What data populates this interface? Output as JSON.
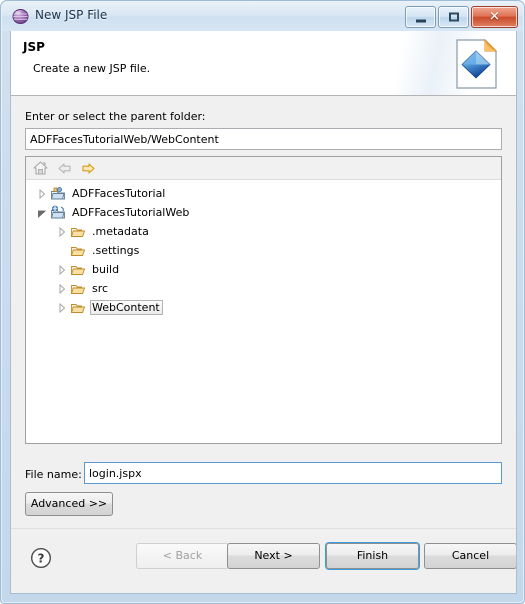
{
  "window": {
    "title": "New JSP File",
    "icon": "eclipse-sphere-icon",
    "controls": {
      "minimize_label": "Minimize",
      "maximize_label": "Restore",
      "close_label": "Close",
      "close_glyph": "✕"
    }
  },
  "header": {
    "title": "JSP",
    "description": "Create a new JSP file.",
    "icon": "jsp-file-wizard-icon"
  },
  "main": {
    "parent_folder": {
      "label": "Enter or select the parent folder:",
      "value": "ADFFacesTutorialWeb/WebContent",
      "placeholder": ""
    },
    "tree_toolbar": [
      {
        "name": "home-icon",
        "enabled": false
      },
      {
        "name": "back-arrow-icon",
        "enabled": false
      },
      {
        "name": "forward-arrow-icon",
        "enabled": true
      }
    ],
    "tree": [
      {
        "label": "ADFFacesTutorial",
        "icon": "project-icon",
        "indent": 0,
        "twisty": "collapsed",
        "selected": false
      },
      {
        "label": "ADFFacesTutorialWeb",
        "icon": "web-project-icon",
        "indent": 0,
        "twisty": "expanded",
        "selected": false
      },
      {
        "label": ".metadata",
        "icon": "folder-icon",
        "indent": 1,
        "twisty": "collapsed",
        "selected": false
      },
      {
        "label": ".settings",
        "icon": "folder-icon",
        "indent": 1,
        "twisty": "none",
        "selected": false
      },
      {
        "label": "build",
        "icon": "folder-icon",
        "indent": 1,
        "twisty": "collapsed",
        "selected": false
      },
      {
        "label": "src",
        "icon": "folder-icon",
        "indent": 1,
        "twisty": "collapsed",
        "selected": false
      },
      {
        "label": "WebContent",
        "icon": "folder-icon",
        "indent": 1,
        "twisty": "collapsed",
        "selected": true
      }
    ],
    "file_name": {
      "label": "File name:",
      "value": "login.jspx",
      "placeholder": ""
    },
    "advanced_label": "Advanced >>"
  },
  "footer": {
    "help_icon": "help-question-icon",
    "back_label": "< Back",
    "next_label": "Next >",
    "finish_label": "Finish",
    "cancel_label": "Cancel"
  },
  "colors": {
    "accent": "#3c9ade",
    "frame": "#9dbcd8",
    "body_bg": "#f0f0f0",
    "close_red": "#c94b2a",
    "folder_orange": "#e8a33d"
  }
}
